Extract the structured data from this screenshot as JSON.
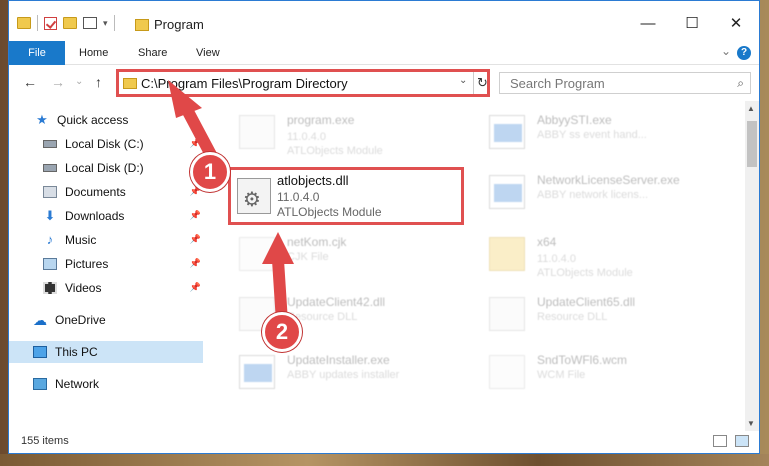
{
  "window": {
    "title": "Program",
    "minimize": "—",
    "maximize": "☐",
    "close": "✕"
  },
  "ribbon": {
    "tabs": [
      "File",
      "Home",
      "Share",
      "View"
    ],
    "expand": "⌄",
    "help": "?"
  },
  "nav": {
    "back": "←",
    "forward": "→",
    "recent": "⌄",
    "up": "↑",
    "address": "C:\\Program Files\\Program Directory",
    "dropdown": "⌄",
    "refresh": "↻",
    "search_placeholder": "Search Program",
    "search_icon": "⌕"
  },
  "sidebar": {
    "items": [
      {
        "label": "Quick access",
        "icon": "star-icon"
      },
      {
        "label": "Local Disk (C:)",
        "icon": "disk-icon",
        "pinned": true
      },
      {
        "label": "Local Disk (D:)",
        "icon": "disk-icon",
        "pinned": true
      },
      {
        "label": "Documents",
        "icon": "documents-icon",
        "pinned": true
      },
      {
        "label": "Downloads",
        "icon": "download-icon",
        "pinned": true
      },
      {
        "label": "Music",
        "icon": "music-icon",
        "pinned": true
      },
      {
        "label": "Pictures",
        "icon": "pictures-icon",
        "pinned": true
      },
      {
        "label": "Videos",
        "icon": "videos-icon",
        "pinned": true
      },
      {
        "label": "OneDrive",
        "icon": "cloud-icon"
      },
      {
        "label": "This PC",
        "icon": "pc-icon",
        "selected": true
      },
      {
        "label": "Network",
        "icon": "network-icon"
      }
    ]
  },
  "files": [
    {
      "name": "program.exe",
      "meta1": "11.0.4.0",
      "meta2": "ATLObjects Module",
      "icon": "exe-icon"
    },
    {
      "name": "AbbyySTI.exe",
      "meta1": "",
      "meta2": "ABBY ss event hand...",
      "icon": "exe-icon"
    },
    {
      "name": "NetworkLicenseServer.exe",
      "meta1": "",
      "meta2": "ABBY network licens...",
      "icon": "exe-icon"
    },
    {
      "name": "netKom.cjk",
      "meta1": "",
      "meta2": "CJK File",
      "icon": "page-icon"
    },
    {
      "name": "x64",
      "meta1": "11.0.4.0",
      "meta2": "ATLObjects Module",
      "icon": "folder-icon"
    },
    {
      "name": "UpdateClient42.dll",
      "meta1": "",
      "meta2": "Resource DLL",
      "icon": "gear-file-icon"
    },
    {
      "name": "UpdateClient65.dll",
      "meta1": "",
      "meta2": "Resource DLL",
      "icon": "gear-file-icon"
    },
    {
      "name": "UpdateInstaller.exe",
      "meta1": "",
      "meta2": "ABBY updates installer",
      "icon": "exe-icon"
    },
    {
      "name": "SndToWFl6.wcm",
      "meta1": "",
      "meta2": "WCM File",
      "icon": "page-icon"
    }
  ],
  "highlighted": {
    "name": "atlobjects.dll",
    "version": "11.0.4.0",
    "description": "ATLObjects Module"
  },
  "status": {
    "count": "155 items"
  },
  "callouts": [
    "1",
    "2"
  ],
  "colors": {
    "accent": "#1979ca",
    "highlight_border": "#e05050",
    "selected_bg": "#cce4f7"
  }
}
